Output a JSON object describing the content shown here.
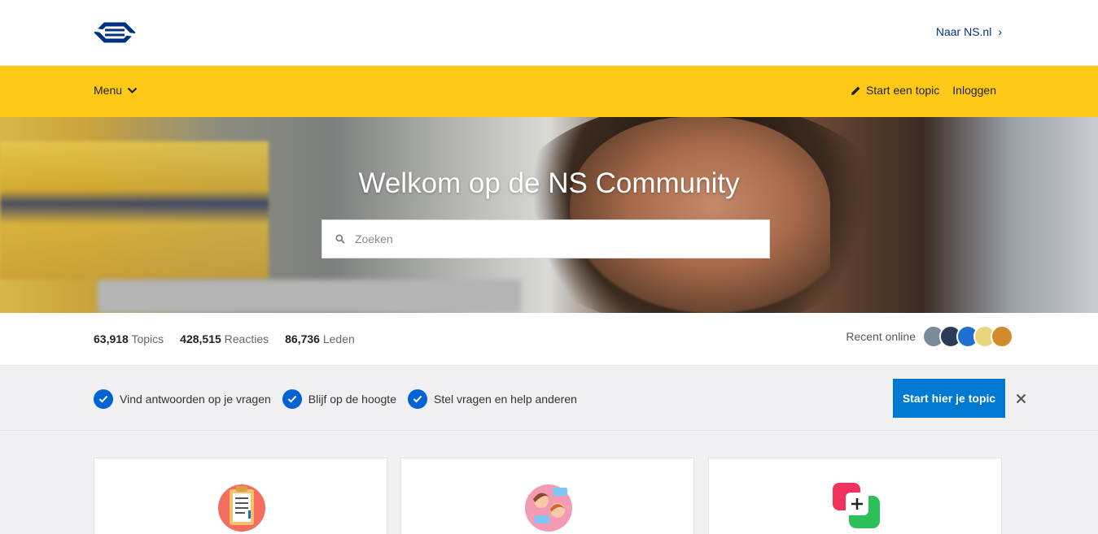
{
  "header": {
    "logo_name": "ns-logo",
    "naar_link": "Naar NS.nl",
    "naar_chevron": "›"
  },
  "nav": {
    "menu_label": "Menu",
    "start_topic": "Start een topic",
    "login": "Inloggen"
  },
  "hero": {
    "title": "Welkom op de NS Community",
    "search_placeholder": "Zoeken"
  },
  "stats": {
    "items": [
      {
        "value": "63,918",
        "label": "Topics"
      },
      {
        "value": "428,515",
        "label": "Reacties"
      },
      {
        "value": "86,736",
        "label": "Leden"
      }
    ],
    "recent_label": "Recent online",
    "avatar_colors": [
      "#7b8a9a",
      "#2b3a55",
      "#1f6fd1",
      "#e9d57a",
      "#d18b2a"
    ]
  },
  "benefits": {
    "items": [
      "Vind antwoorden op je vragen",
      "Blijf op de hoogte",
      "Stel vragen en help anderen"
    ],
    "cta": "Start hier je topic",
    "close_icon": "close-icon"
  },
  "colors": {
    "brand_yellow": "#ffc917",
    "brand_blue": "#003082",
    "cta_blue": "#0079d3"
  },
  "cards": [
    {
      "icon": "clipboard-icon"
    },
    {
      "icon": "conversation-icon"
    },
    {
      "icon": "add-topic-icon"
    }
  ]
}
